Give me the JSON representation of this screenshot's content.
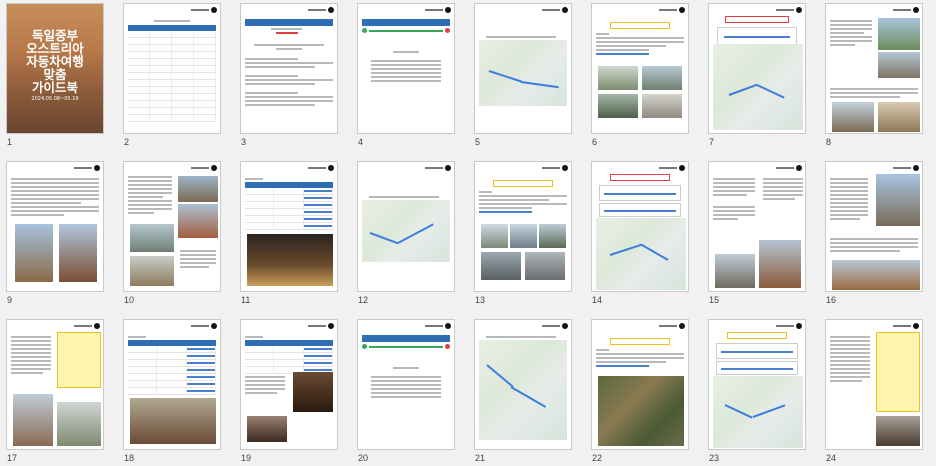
{
  "viewer": {
    "pages": [
      {
        "number": "1",
        "kind": "cover"
      },
      {
        "number": "2",
        "kind": "table"
      },
      {
        "number": "3",
        "kind": "intro"
      },
      {
        "number": "4",
        "kind": "notice"
      },
      {
        "number": "5",
        "kind": "map"
      },
      {
        "number": "6",
        "kind": "place"
      },
      {
        "number": "7",
        "kind": "routemap"
      },
      {
        "number": "8",
        "kind": "article"
      },
      {
        "number": "9",
        "kind": "article2"
      },
      {
        "number": "10",
        "kind": "article3"
      },
      {
        "number": "11",
        "kind": "listphoto"
      },
      {
        "number": "12",
        "kind": "map"
      },
      {
        "number": "13",
        "kind": "place"
      },
      {
        "number": "14",
        "kind": "routemap"
      },
      {
        "number": "15",
        "kind": "article4"
      },
      {
        "number": "16",
        "kind": "article5"
      },
      {
        "number": "17",
        "kind": "article6"
      },
      {
        "number": "18",
        "kind": "listphoto2"
      },
      {
        "number": "19",
        "kind": "listphoto3"
      },
      {
        "number": "20",
        "kind": "notice"
      },
      {
        "number": "21",
        "kind": "map"
      },
      {
        "number": "22",
        "kind": "aerial"
      },
      {
        "number": "23",
        "kind": "routemap"
      },
      {
        "number": "24",
        "kind": "article7"
      }
    ]
  },
  "cover": {
    "title_line1": "독일중부",
    "title_line2": "오스트리아",
    "title_line3": "자동차여행",
    "title_line4": "맞춤",
    "title_line5": "가이드북",
    "date": "2024.05.08~05.19"
  },
  "colors": {
    "accent_blue": "#2e6fb3",
    "route_blue": "#3b7ee0",
    "highlight_yellow": "#f0c020"
  }
}
